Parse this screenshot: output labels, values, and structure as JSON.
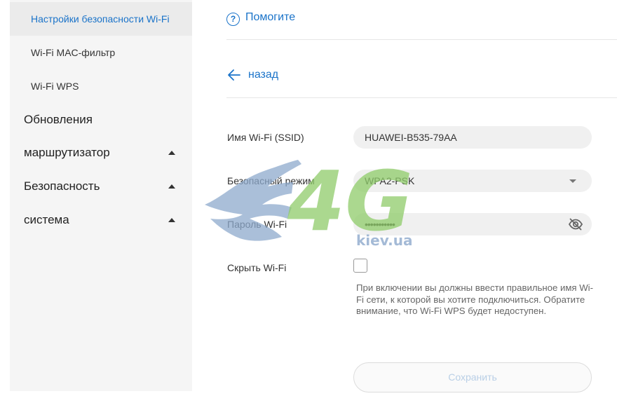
{
  "sidebar": {
    "sub_items": [
      {
        "label": "Настройки безопасности Wi-Fi",
        "active": true
      },
      {
        "label": "Wi-Fi MAC-фильтр",
        "active": false
      },
      {
        "label": "Wi-Fi WPS",
        "active": false
      }
    ],
    "groups": [
      {
        "label": "Обновления",
        "expanded": false
      },
      {
        "label": "маршрутизатор",
        "expanded": true
      },
      {
        "label": "Безопасность",
        "expanded": true
      },
      {
        "label": "система",
        "expanded": true
      }
    ]
  },
  "header": {
    "help_icon": "question-circle-icon",
    "help_label": "Помогите",
    "back_icon": "arrow-left-icon",
    "back_label": "назад"
  },
  "form": {
    "ssid": {
      "label": "Имя Wi-Fi (SSID)",
      "value": "HUAWEI-B535-79AA"
    },
    "security_mode": {
      "label": "Безопасный режим",
      "value": "WPA2-PSK"
    },
    "password": {
      "label": "Пароль Wi-Fi",
      "value": "•••••••••••",
      "icon": "eye-off-icon"
    },
    "hide_wifi": {
      "label": "Скрыть Wi-Fi",
      "checked": false
    },
    "hint": "При включении вы должны ввести правильное имя Wi-Fi сети, к которой вы хотите подключиться. Обратите внимание, что Wi-Fi WPS будет недоступен.",
    "save_label": "Сохранить"
  },
  "watermark": {
    "logo_text": "4G",
    "site_text": "kiev.ua"
  },
  "colors": {
    "accent": "#1a73c9",
    "sidebar_bg": "#f5f5f5",
    "field_bg": "#f0f0f0"
  }
}
